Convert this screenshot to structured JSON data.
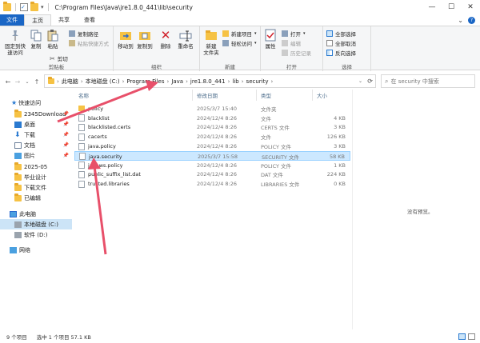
{
  "titlebar": {
    "path": "C:\\Program Files\\Java\\jre1.8.0_441\\lib\\security"
  },
  "window_controls": {
    "minimize": "—",
    "maximize": "☐",
    "close": "✕"
  },
  "tabs": {
    "file": "文件",
    "home": "主页",
    "share": "共享",
    "view": "查看"
  },
  "ribbon": {
    "clipboard": {
      "pin_quick": "固定到快\n速访问",
      "copy": "复制",
      "paste": "粘贴",
      "copy_path": "复制路径",
      "paste_shortcut": "粘贴快捷方式",
      "cut": "剪切",
      "label": "剪贴板"
    },
    "organize": {
      "move_to": "移动到",
      "copy_to": "复制到",
      "delete": "删除",
      "rename": "重命名",
      "label": "组织"
    },
    "new": {
      "new_folder": "新建\n文件夹",
      "new_item": "新建项目",
      "easy_access": "轻松访问",
      "label": "新建"
    },
    "open": {
      "properties": "属性",
      "open": "打开",
      "edit": "编辑",
      "history": "历史记录",
      "label": "打开"
    },
    "select": {
      "select_all": "全部选择",
      "select_none": "全部取消",
      "invert": "反向选择",
      "label": "选择"
    }
  },
  "address": {
    "crumbs": [
      "此电脑",
      "本地磁盘 (C:)",
      "Program Files",
      "Java",
      "jre1.8.0_441",
      "lib",
      "security"
    ],
    "search_placeholder": "在 security 中搜索"
  },
  "nav": {
    "quick_access": "快速访问",
    "items": [
      {
        "label": "2345Download",
        "pinned": true
      },
      {
        "label": "桌面",
        "pinned": true
      },
      {
        "label": "下载",
        "pinned": true
      },
      {
        "label": "文档",
        "pinned": true
      },
      {
        "label": "图片",
        "pinned": true
      },
      {
        "label": "2025-05",
        "pinned": false
      },
      {
        "label": "毕业设计",
        "pinned": false
      },
      {
        "label": "下载文件",
        "pinned": false
      },
      {
        "label": "已编辑",
        "pinned": false
      }
    ],
    "this_pc": "此电脑",
    "drive_c": "本地磁盘 (C:)",
    "drive_d": "软件 (D:)",
    "network": "网络"
  },
  "columns": {
    "name": "名称",
    "date": "修改日期",
    "type": "类型",
    "size": "大小"
  },
  "files": [
    {
      "name": "policy",
      "date": "2025/3/7 15:40",
      "type": "文件夹",
      "size": "",
      "folder": true
    },
    {
      "name": "blacklist",
      "date": "2024/12/4 8:26",
      "type": "文件",
      "size": "4 KB",
      "folder": false
    },
    {
      "name": "blacklisted.certs",
      "date": "2024/12/4 8:26",
      "type": "CERTS 文件",
      "size": "3 KB",
      "folder": false
    },
    {
      "name": "cacerts",
      "date": "2024/12/4 8:26",
      "type": "文件",
      "size": "126 KB",
      "folder": false
    },
    {
      "name": "java.policy",
      "date": "2024/12/4 8:26",
      "type": "POLICY 文件",
      "size": "3 KB",
      "folder": false
    },
    {
      "name": "java.security",
      "date": "2025/3/7 15:58",
      "type": "SECURITY 文件",
      "size": "58 KB",
      "folder": false,
      "selected": true
    },
    {
      "name": "javaws.policy",
      "date": "2024/12/4 8:26",
      "type": "POLICY 文件",
      "size": "1 KB",
      "folder": false
    },
    {
      "name": "public_suffix_list.dat",
      "date": "2024/12/4 8:26",
      "type": "DAT 文件",
      "size": "224 KB",
      "folder": false
    },
    {
      "name": "trusted.libraries",
      "date": "2024/12/4 8:26",
      "type": "LIBRARIES 文件",
      "size": "0 KB",
      "folder": false
    }
  ],
  "preview": {
    "message": "没有预览。"
  },
  "status": {
    "count": "9 个项目",
    "selected": "选中 1 个项目  57.1 KB"
  },
  "colors": {
    "accent": "#1a66c5",
    "selection": "#cce8ff",
    "arrow": "#e8506a"
  }
}
